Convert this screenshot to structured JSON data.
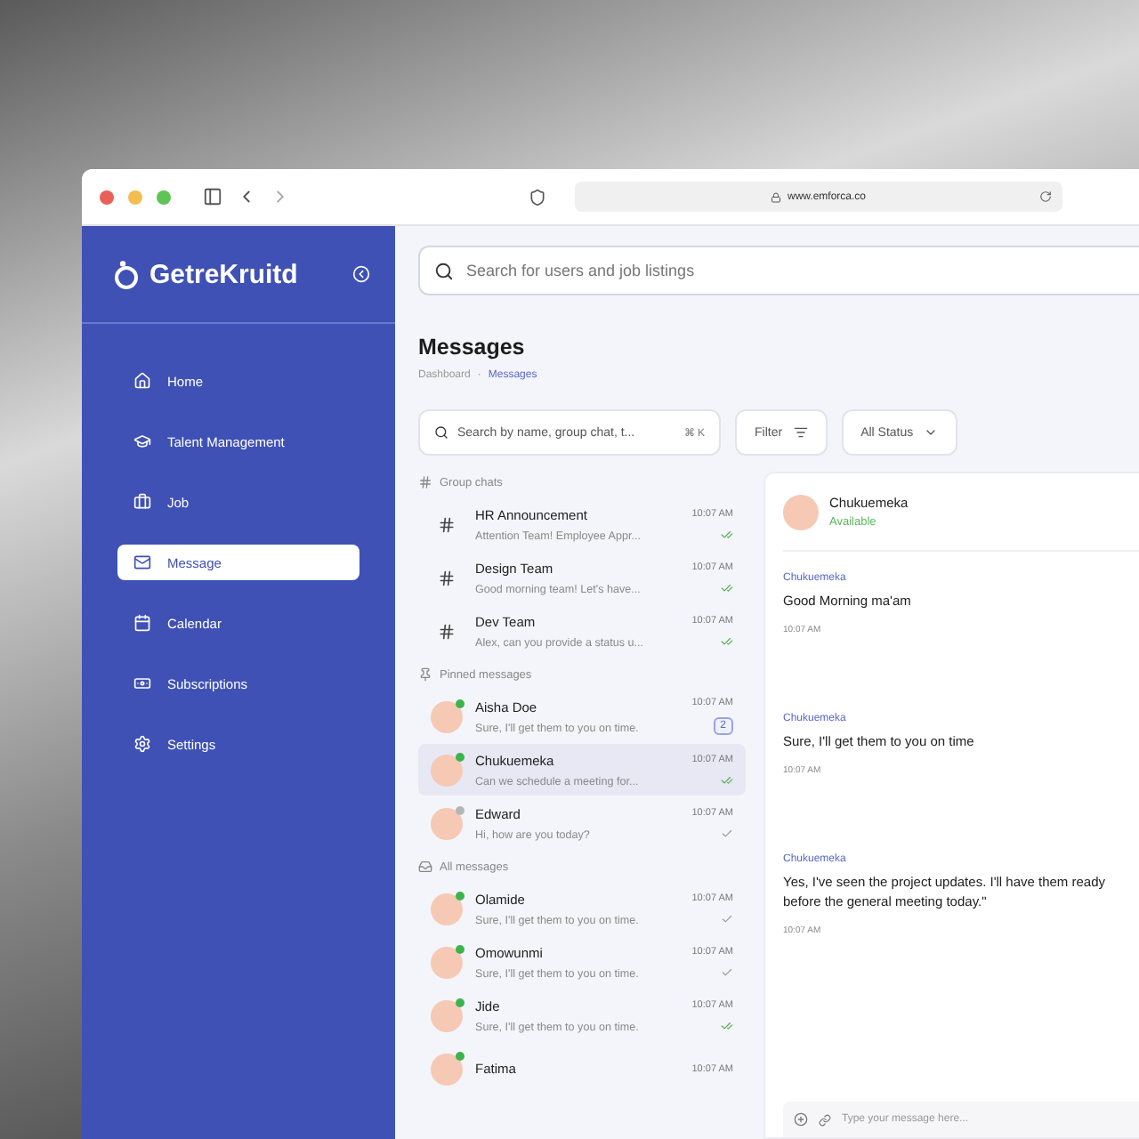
{
  "browser": {
    "url": "www.emforca.co"
  },
  "sidebar": {
    "brand": "GetreKruitd",
    "items": [
      {
        "label": "Home",
        "selected": false
      },
      {
        "label": "Talent Management",
        "selected": false
      },
      {
        "label": "Job",
        "selected": false
      },
      {
        "label": "Message",
        "selected": true
      },
      {
        "label": "Calendar",
        "selected": false
      },
      {
        "label": "Subscriptions",
        "selected": false
      },
      {
        "label": "Settings",
        "selected": false
      }
    ]
  },
  "top_search": {
    "placeholder": "Search for users and job listings"
  },
  "page": {
    "title": "Messages",
    "breadcrumb": [
      "Dashboard",
      "Messages"
    ],
    "breadcrumb_separator": "·"
  },
  "filters": {
    "search_placeholder": "Search by name, group chat, t...",
    "shortcut": "⌘ K",
    "filter": "Filter",
    "status": "All Status"
  },
  "sections": [
    {
      "kind": "group",
      "title": "Group chats",
      "conversations": [
        {
          "name": "HR Announcement",
          "preview": "Attention Team! Employee Appr...",
          "time": "10:07 AM",
          "read": true,
          "selected": false
        },
        {
          "name": "Design Team",
          "preview": "Good morning team! Let's have...",
          "time": "10:07 AM",
          "read": true,
          "selected": false
        },
        {
          "name": "Dev Team",
          "preview": "Alex, can you provide a status u...",
          "time": "10:07 AM",
          "read": true,
          "selected": false
        }
      ]
    },
    {
      "kind": "pinned",
      "title": "Pinned messages",
      "conversations": [
        {
          "name": "Aisha Doe",
          "preview": "Sure, I'll get them to you on time.",
          "time": "10:07 AM",
          "unread": "2",
          "online": true,
          "selected": false
        },
        {
          "name": "Chukuemeka",
          "preview": "Can we schedule a meeting for...",
          "time": "10:07 AM",
          "read": true,
          "online": true,
          "selected": true
        },
        {
          "name": "Edward",
          "preview": "Hi, how are you today?",
          "time": "10:07 AM",
          "read": false,
          "online": false,
          "selected": false
        }
      ]
    },
    {
      "kind": "all",
      "title": "All messages",
      "conversations": [
        {
          "name": "Olamide",
          "preview": "Sure, I'll get them to you on time.",
          "time": "10:07 AM",
          "read": false,
          "online": true,
          "selected": false
        },
        {
          "name": "Omowunmi",
          "preview": "Sure, I'll get them to you on time.",
          "time": "10:07 AM",
          "read": false,
          "online": true,
          "selected": false
        },
        {
          "name": "Jide",
          "preview": "Sure, I'll get them to you on time.",
          "time": "10:07 AM",
          "read": true,
          "online": true,
          "selected": false
        },
        {
          "name": "Fatima",
          "time": "10:07 AM",
          "online": true,
          "selected": false
        }
      ]
    }
  ],
  "chat": {
    "name": "Chukuemeka",
    "presence": "Available",
    "messages": [
      {
        "sender": "Chukuemeka",
        "text": "Good Morning ma'am",
        "time": "10:07 AM"
      },
      {
        "sender": "Chukuemeka",
        "text": "Sure, I'll get them to you on time",
        "time": "10:07 AM"
      },
      {
        "sender": "Chukuemeka",
        "text": "Yes, I've seen the project updates. I'll have them ready before the general meeting today.\"",
        "time": "10:07 AM"
      }
    ],
    "composer_placeholder": "Type your message here..."
  }
}
